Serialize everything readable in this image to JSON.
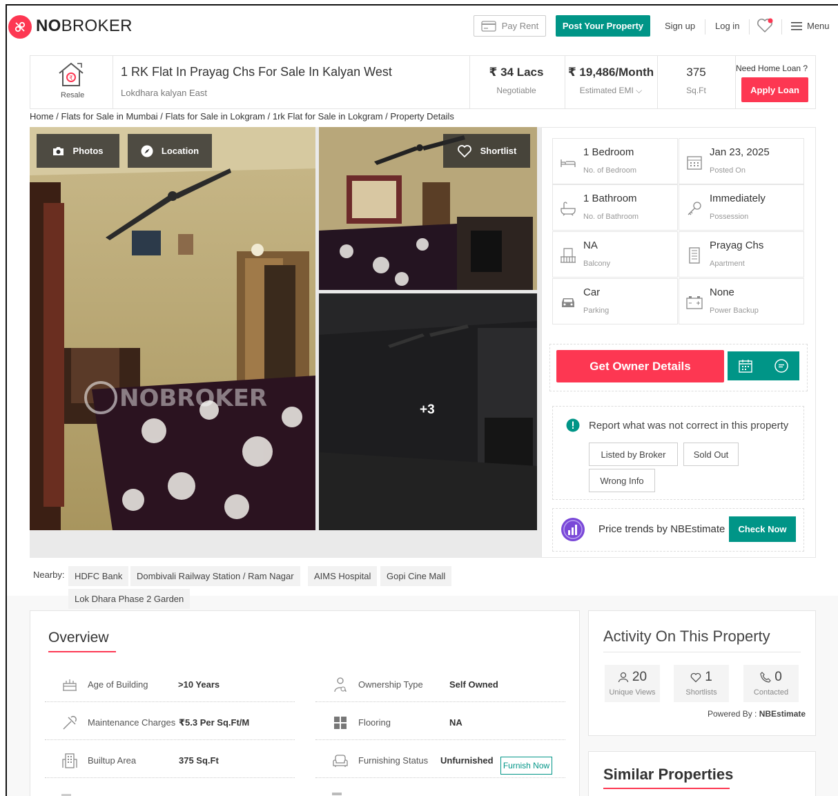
{
  "header": {
    "logo_bold": "NO",
    "logo_rest": "BROKER",
    "pay_rent": "Pay Rent",
    "post_property": "Post Your Property",
    "sign_up": "Sign up",
    "log_in": "Log in",
    "menu": "Menu"
  },
  "summary": {
    "badge": "Resale",
    "title": "1 RK Flat In Prayag Chs For Sale In Kalyan West",
    "locality": "Lokdhara kalyan East",
    "price": "₹ 34 Lacs",
    "price_note": "Negotiable",
    "emi": "₹ 19,486/Month",
    "emi_note": "Estimated EMI",
    "area": "375",
    "area_unit": "Sq.Ft",
    "loan_prompt": "Need Home Loan ?",
    "apply_loan": "Apply Loan"
  },
  "breadcrumb": "Home / Flats for Sale in Mumbai / Flats for Sale in Lokgram / 1rk Flat for Sale in Lokgram / Property Details",
  "gallery": {
    "photos_btn": "Photos",
    "location_btn": "Location",
    "shortlist_btn": "Shortlist",
    "more_count": "+3"
  },
  "specs": [
    {
      "value": "1 Bedroom",
      "label": "No. of Bedroom",
      "icon": "bed-icon"
    },
    {
      "value": "Jan 23, 2025",
      "label": "Posted On",
      "icon": "calendar-icon"
    },
    {
      "value": "1 Bathroom",
      "label": "No. of Bathroom",
      "icon": "bathtub-icon"
    },
    {
      "value": "Immediately",
      "label": "Possession",
      "icon": "key-icon"
    },
    {
      "value": "NA",
      "label": "Balcony",
      "icon": "balcony-icon"
    },
    {
      "value": "Prayag Chs",
      "label": "Apartment",
      "icon": "building-icon"
    },
    {
      "value": "Car",
      "label": "Parking",
      "icon": "car-icon"
    },
    {
      "value": "None",
      "label": "Power Backup",
      "icon": "battery-icon"
    }
  ],
  "actions": {
    "get_owner": "Get Owner Details"
  },
  "report": {
    "text": "Report what was not correct in this property",
    "options": [
      "Listed by Broker",
      "Sold Out",
      "Wrong Info"
    ]
  },
  "trend": {
    "text": "Price trends by NBEstimate",
    "cta": "Check Now"
  },
  "nearby": {
    "label": "Nearby:",
    "items": [
      "HDFC Bank",
      "Dombivali Railway Station / Ram Nagar",
      "AIMS Hospital",
      "Gopi Cine Mall",
      "Lok Dhara Phase 2 Garden"
    ]
  },
  "overview": {
    "title": "Overview",
    "rows": [
      {
        "label": "Age of Building",
        "value": ">10 Years"
      },
      {
        "label": "Ownership Type",
        "value": "Self Owned"
      },
      {
        "label": "Maintenance Charges",
        "value": "₹5.3 Per Sq.Ft/M"
      },
      {
        "label": "Flooring",
        "value": "NA"
      },
      {
        "label": "Builtup Area",
        "value": "375 Sq.Ft"
      },
      {
        "label": "Furnishing Status",
        "value": "Unfurnished"
      }
    ],
    "furnish_now": "Furnish Now"
  },
  "activity": {
    "title": "Activity On This Property",
    "stats": [
      {
        "count": "20",
        "label": "Unique Views"
      },
      {
        "count": "1",
        "label": "Shortlists"
      },
      {
        "count": "0",
        "label": "Contacted"
      }
    ],
    "powered_label": "Powered By :",
    "powered_by": "NBEstimate"
  },
  "similar": {
    "title": "Similar Properties"
  },
  "colors": {
    "brand_red": "#fd3752",
    "brand_teal": "#009587"
  }
}
